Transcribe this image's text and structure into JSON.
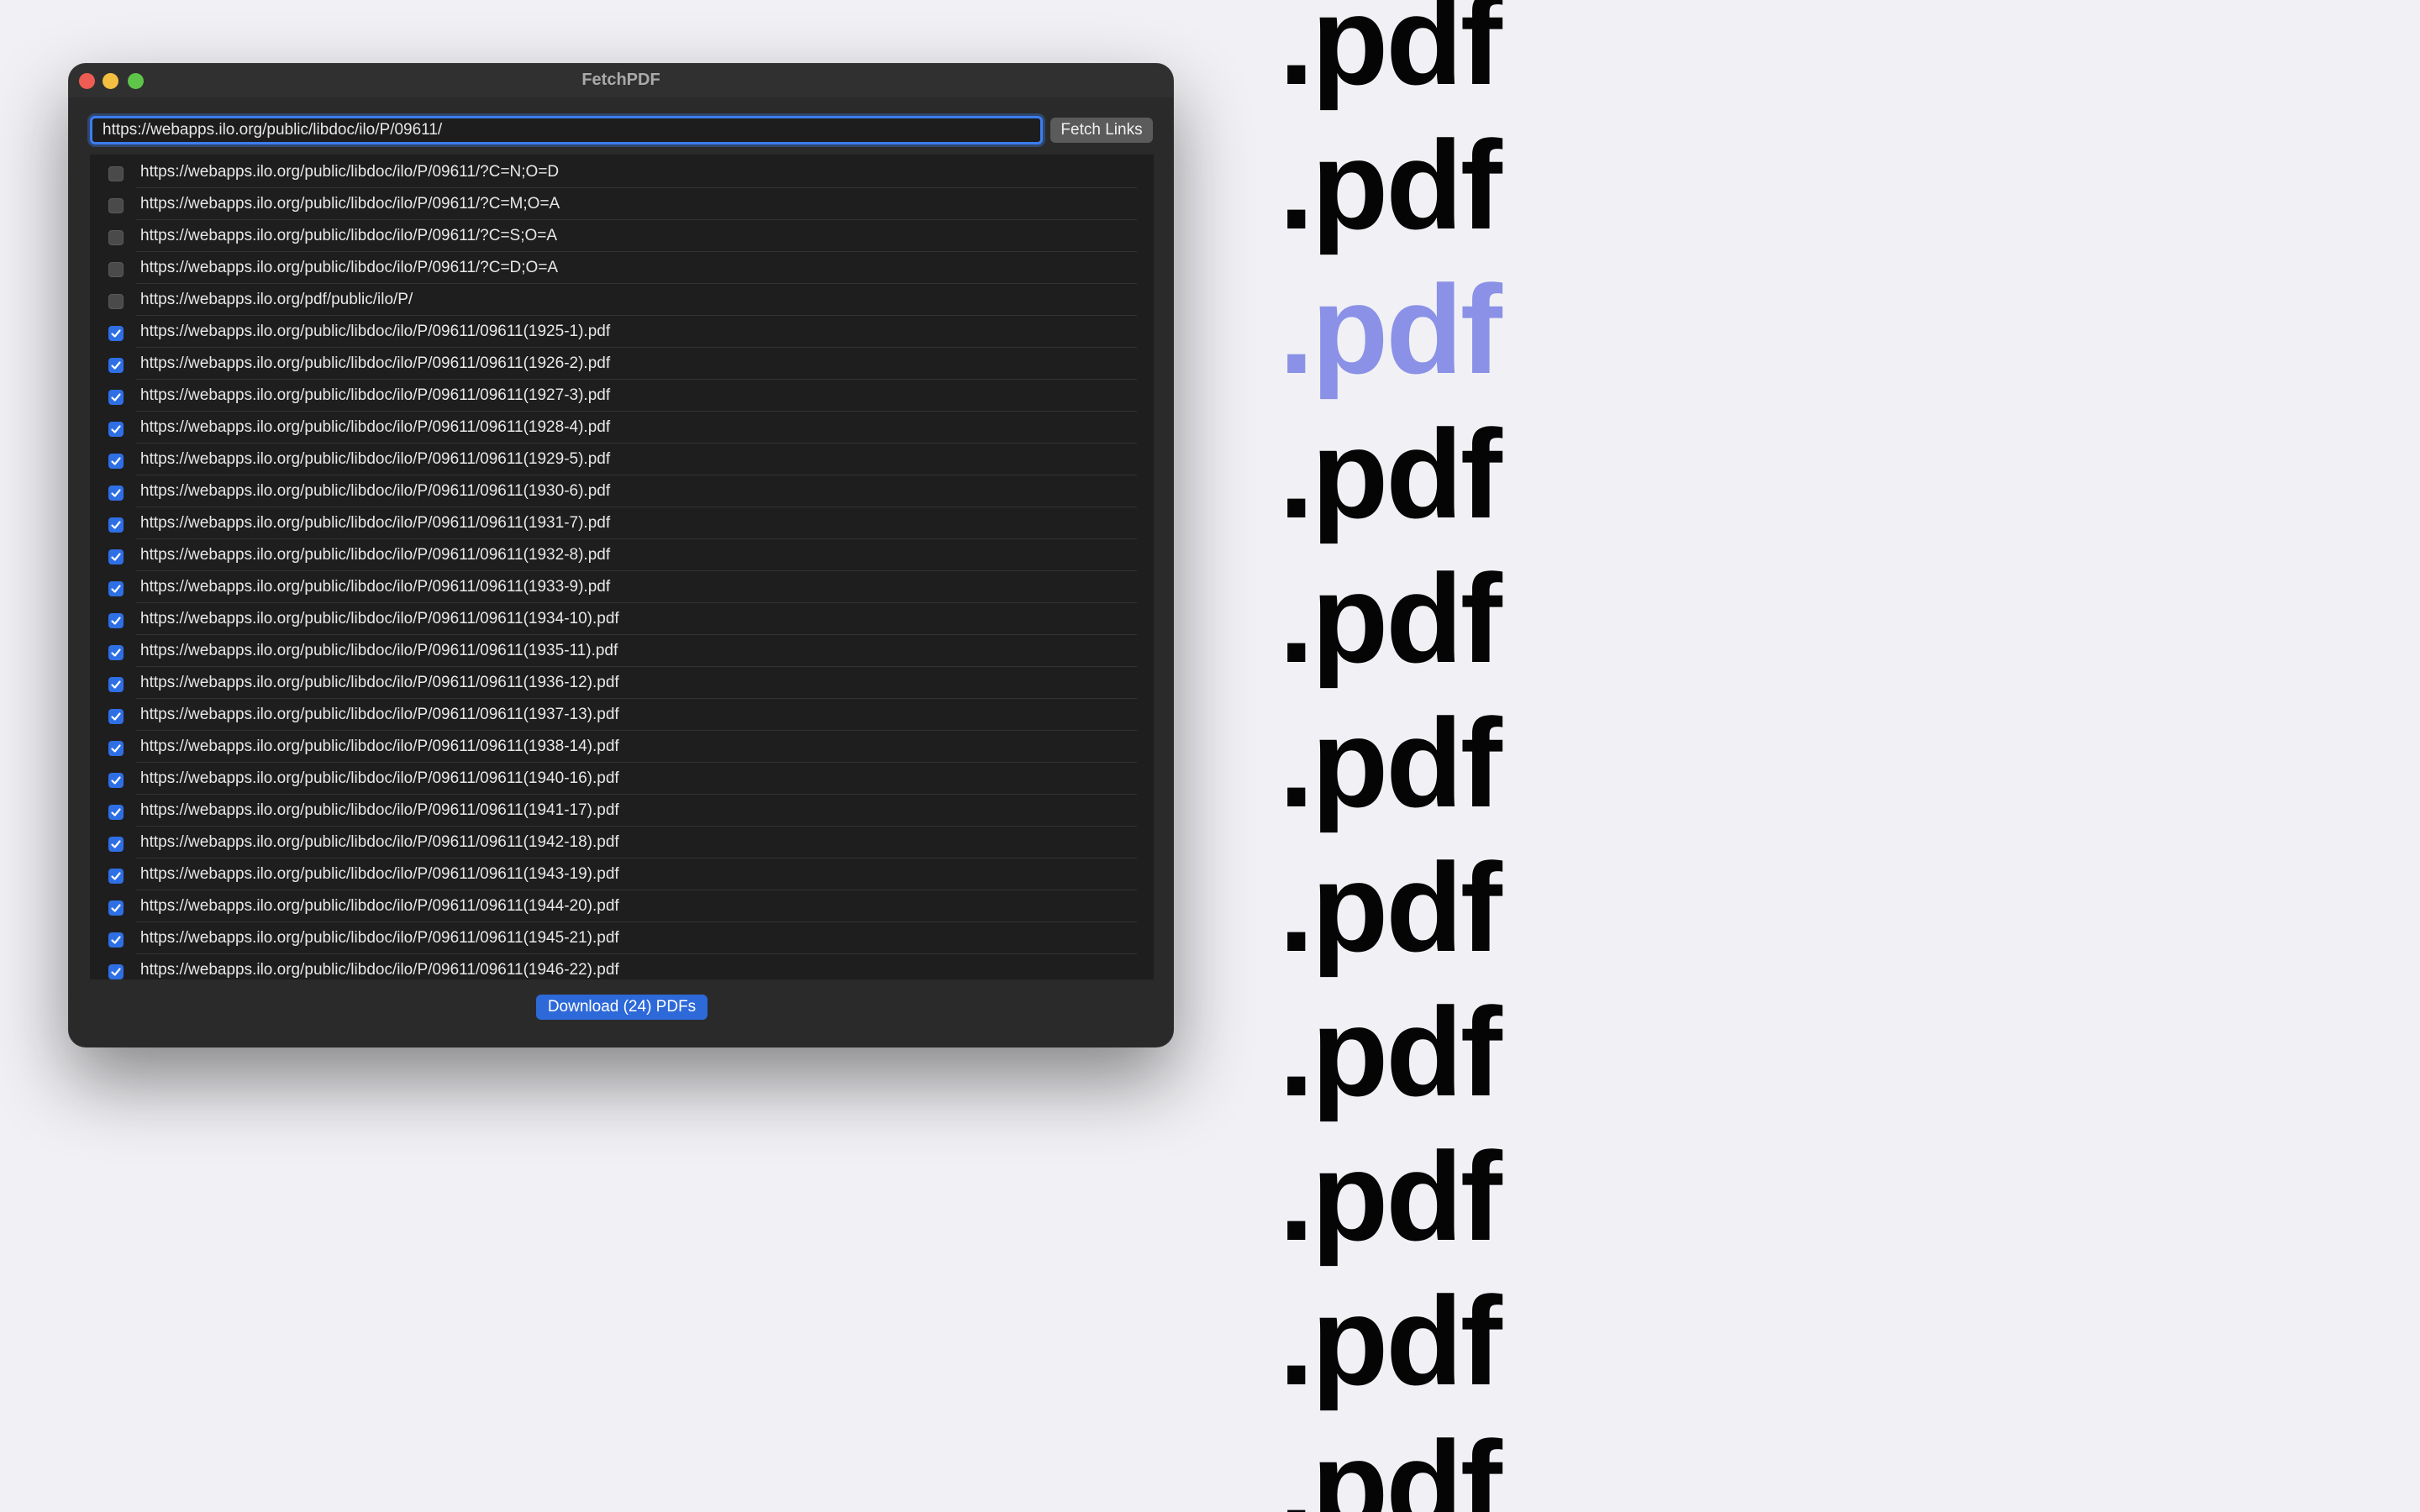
{
  "background": {
    "word": ".pdf",
    "count": 11,
    "accent_index": 2,
    "colors": {
      "desktop": "#f1f1f5",
      "word": "#050505",
      "accent_word": "#8a91e6"
    }
  },
  "window": {
    "title": "FetchPDF",
    "colors": {
      "background": "#2a2a2a",
      "accent": "#2d69d8"
    }
  },
  "toolbar": {
    "url_value": "https://webapps.ilo.org/public/libdoc/ilo/P/09611/",
    "fetch_label": "Fetch Links"
  },
  "links": [
    {
      "url": "https://webapps.ilo.org/public/libdoc/ilo/P/09611/?C=N;O=D",
      "checked": false
    },
    {
      "url": "https://webapps.ilo.org/public/libdoc/ilo/P/09611/?C=M;O=A",
      "checked": false
    },
    {
      "url": "https://webapps.ilo.org/public/libdoc/ilo/P/09611/?C=S;O=A",
      "checked": false
    },
    {
      "url": "https://webapps.ilo.org/public/libdoc/ilo/P/09611/?C=D;O=A",
      "checked": false
    },
    {
      "url": "https://webapps.ilo.org/pdf/public/ilo/P/",
      "checked": false
    },
    {
      "url": "https://webapps.ilo.org/public/libdoc/ilo/P/09611/09611(1925-1).pdf",
      "checked": true
    },
    {
      "url": "https://webapps.ilo.org/public/libdoc/ilo/P/09611/09611(1926-2).pdf",
      "checked": true
    },
    {
      "url": "https://webapps.ilo.org/public/libdoc/ilo/P/09611/09611(1927-3).pdf",
      "checked": true
    },
    {
      "url": "https://webapps.ilo.org/public/libdoc/ilo/P/09611/09611(1928-4).pdf",
      "checked": true
    },
    {
      "url": "https://webapps.ilo.org/public/libdoc/ilo/P/09611/09611(1929-5).pdf",
      "checked": true
    },
    {
      "url": "https://webapps.ilo.org/public/libdoc/ilo/P/09611/09611(1930-6).pdf",
      "checked": true
    },
    {
      "url": "https://webapps.ilo.org/public/libdoc/ilo/P/09611/09611(1931-7).pdf",
      "checked": true
    },
    {
      "url": "https://webapps.ilo.org/public/libdoc/ilo/P/09611/09611(1932-8).pdf",
      "checked": true
    },
    {
      "url": "https://webapps.ilo.org/public/libdoc/ilo/P/09611/09611(1933-9).pdf",
      "checked": true
    },
    {
      "url": "https://webapps.ilo.org/public/libdoc/ilo/P/09611/09611(1934-10).pdf",
      "checked": true
    },
    {
      "url": "https://webapps.ilo.org/public/libdoc/ilo/P/09611/09611(1935-11).pdf",
      "checked": true
    },
    {
      "url": "https://webapps.ilo.org/public/libdoc/ilo/P/09611/09611(1936-12).pdf",
      "checked": true
    },
    {
      "url": "https://webapps.ilo.org/public/libdoc/ilo/P/09611/09611(1937-13).pdf",
      "checked": true
    },
    {
      "url": "https://webapps.ilo.org/public/libdoc/ilo/P/09611/09611(1938-14).pdf",
      "checked": true
    },
    {
      "url": "https://webapps.ilo.org/public/libdoc/ilo/P/09611/09611(1940-16).pdf",
      "checked": true
    },
    {
      "url": "https://webapps.ilo.org/public/libdoc/ilo/P/09611/09611(1941-17).pdf",
      "checked": true
    },
    {
      "url": "https://webapps.ilo.org/public/libdoc/ilo/P/09611/09611(1942-18).pdf",
      "checked": true
    },
    {
      "url": "https://webapps.ilo.org/public/libdoc/ilo/P/09611/09611(1943-19).pdf",
      "checked": true
    },
    {
      "url": "https://webapps.ilo.org/public/libdoc/ilo/P/09611/09611(1944-20).pdf",
      "checked": true
    },
    {
      "url": "https://webapps.ilo.org/public/libdoc/ilo/P/09611/09611(1945-21).pdf",
      "checked": true
    },
    {
      "url": "https://webapps.ilo.org/public/libdoc/ilo/P/09611/09611(1946-22).pdf",
      "checked": true
    }
  ],
  "download_label": "Download (24) PDFs"
}
